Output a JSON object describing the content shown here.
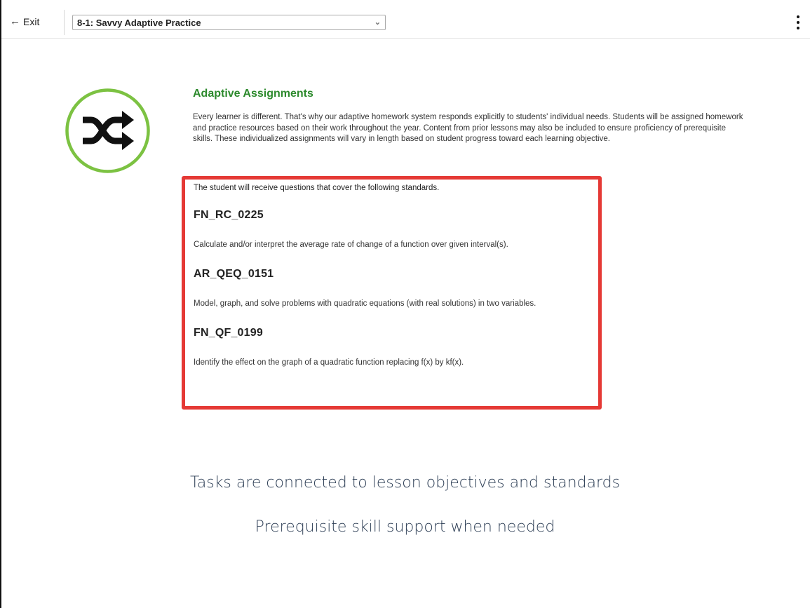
{
  "topbar": {
    "exit_label": "Exit",
    "assignment_selected": "8-1: Savvy Adaptive Practice"
  },
  "section": {
    "title": "Adaptive Assignments",
    "description": "Every learner is different. That's why our adaptive homework system responds explicitly to students' individual needs. Students will be assigned homework and practice resources based on their work throughout the year. Content from prior lessons may also be included to ensure proficiency of prerequisite skills. These individualized assignments will vary in length based on student progress toward each learning objective."
  },
  "standards_box": {
    "intro": "The student will receive questions that cover the following standards.",
    "standards": [
      {
        "code": "FN_RC_0225",
        "description": "Calculate and/or interpret the average rate of change of a function over given interval(s)."
      },
      {
        "code": "AR_QEQ_0151",
        "description": "Model, graph, and solve problems with quadratic equations (with real solutions) in two variables."
      },
      {
        "code": "FN_QF_0199",
        "description": "Identify the effect on the graph of a quadratic function replacing f(x) by kf(x)."
      }
    ]
  },
  "taglines": [
    "Tasks are connected to lesson objectives and standards",
    "Prerequisite skill support when needed"
  ],
  "icons": {
    "logo": "shuffle-icon",
    "exit": "arrow-left-icon",
    "menu": "kebab-menu-icon",
    "dropdown": "chevron-down-icon"
  },
  "colors": {
    "accent_green": "#2d8a2d",
    "logo_ring": "#7cc242",
    "highlight_red": "#e53935",
    "tagline": "#2d3e55"
  }
}
